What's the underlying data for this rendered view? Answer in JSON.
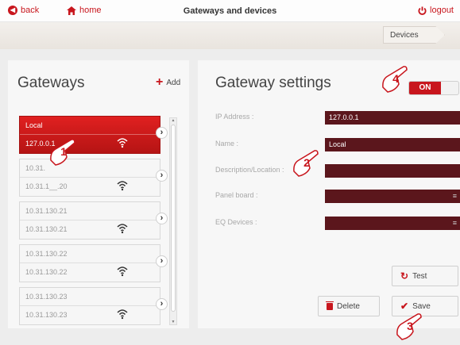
{
  "topbar": {
    "back_label": "back",
    "home_label": "home",
    "title": "Gateways and devices",
    "logout_label": "logout"
  },
  "breadcrumb": {
    "current": "Devices"
  },
  "gateways": {
    "title": "Gateways",
    "add_label": "Add",
    "items": [
      {
        "line1": "Local",
        "line2": "127.0.0.1",
        "active": true
      },
      {
        "line1": "10.31.",
        "line2": "10.31.1__.20",
        "active": false
      },
      {
        "line1": "10.31.130.21",
        "line2": "10.31.130.21",
        "active": false
      },
      {
        "line1": "10.31.130.22",
        "line2": "10.31.130.22",
        "active": false
      },
      {
        "line1": "10.31.130.23",
        "line2": "10.31.130.23",
        "active": false
      }
    ]
  },
  "settings": {
    "title": "Gateway settings",
    "toggle_label": "ON",
    "fields": [
      {
        "label": "IP Address :",
        "value": "127.0.0.1",
        "type": "text"
      },
      {
        "label": "Name :",
        "value": "Local",
        "type": "text"
      },
      {
        "label": "Description/Location :",
        "value": "",
        "type": "text"
      },
      {
        "label": "Panel board :",
        "value": "",
        "type": "select"
      },
      {
        "label": "EQ Devices :",
        "value": "",
        "type": "select"
      }
    ],
    "test_label": "Test",
    "delete_label": "Delete",
    "save_label": "Save"
  },
  "callouts": [
    "1",
    "2",
    "3",
    "4"
  ],
  "colors": {
    "accent": "#c8161d",
    "field_bg": "#5b161c",
    "panel_bg": "#f7f7f7",
    "page_bg": "#ededed"
  }
}
